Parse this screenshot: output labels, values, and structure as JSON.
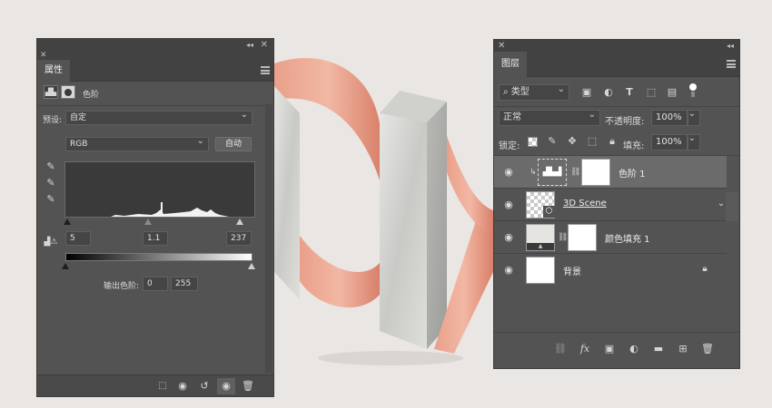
{
  "colors": {
    "panel_bg": "#535353",
    "panel_dark": "#424242",
    "copper": "#e4937c",
    "marble": "#d9d9d6",
    "selected_row": "#6b6b6b"
  },
  "properties_panel": {
    "tab_label": "属性",
    "adjustment_icon": "levels-icon",
    "mask_icon": "mask-icon",
    "adjustment_title": "色阶",
    "preset_label": "预设:",
    "preset_value": "自定",
    "channel_value": "RGB",
    "auto_button": "自动",
    "input_black": "5",
    "input_gamma": "1.1",
    "input_white": "237",
    "output_label": "输出色阶:",
    "output_black": "0",
    "output_white": "255",
    "footer_icons": [
      "clip-to-layer-icon",
      "view-previous-icon",
      "reset-icon",
      "visibility-icon",
      "trash-icon"
    ]
  },
  "layers_panel": {
    "tab_label": "图层",
    "filter_kind": "类型",
    "filter_icons": [
      "image-filter-icon",
      "adjustment-filter-icon",
      "type-filter-icon",
      "shape-filter-icon",
      "smart-object-filter-icon",
      "filter-toggle-icon"
    ],
    "blend_mode": "正常",
    "opacity_label": "不透明度:",
    "opacity_value": "100%",
    "lock_label": "锁定:",
    "fill_label": "填充:",
    "fill_value": "100%",
    "layers": [
      {
        "name": "色阶 1",
        "type": "adjustment",
        "selected": true
      },
      {
        "name": "3D Scene",
        "type": "smart-object",
        "selected": false
      },
      {
        "name": "颜色填充 1",
        "type": "fill",
        "selected": false
      },
      {
        "name": "背景",
        "type": "background",
        "selected": false
      }
    ],
    "footer_icons": [
      "link-icon",
      "fx-icon",
      "add-mask-icon",
      "new-adjustment-icon",
      "group-icon",
      "new-layer-icon",
      "trash-icon"
    ]
  }
}
